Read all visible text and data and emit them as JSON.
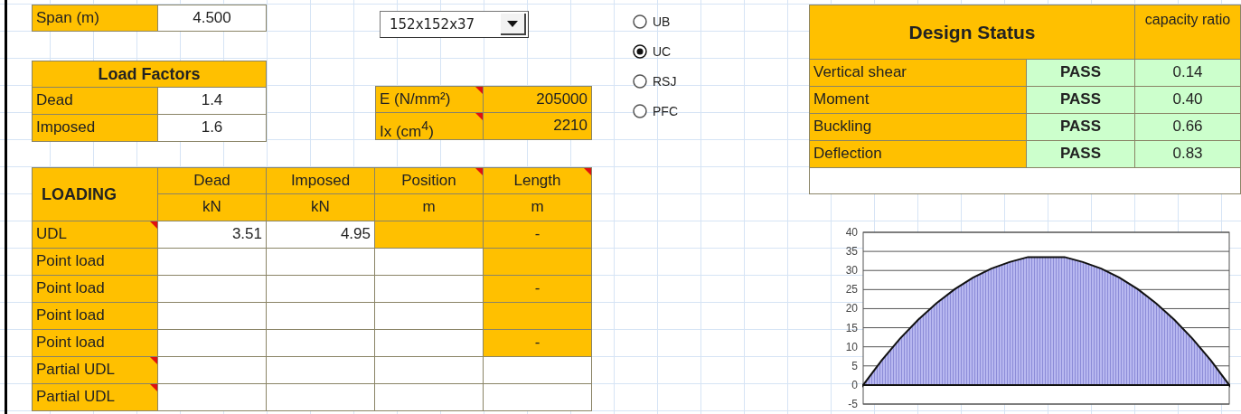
{
  "span": {
    "label": "Span (m)",
    "value": "4.500"
  },
  "load_factors": {
    "title": "Load Factors",
    "rows": [
      {
        "label": "Dead",
        "value": "1.4"
      },
      {
        "label": "Imposed",
        "value": "1.6"
      }
    ]
  },
  "section_dropdown": {
    "value": "152x152x37"
  },
  "properties": [
    {
      "label": "E (N/mm²)",
      "value": "205000",
      "comment": true
    },
    {
      "label": "Ix (cm$^{4}$)",
      "value": "2210",
      "comment": true
    }
  ],
  "section_types": [
    {
      "label": "UB",
      "selected": false
    },
    {
      "label": "UC",
      "selected": true
    },
    {
      "label": "RSJ",
      "selected": false
    },
    {
      "label": "PFC",
      "selected": false
    }
  ],
  "loading": {
    "title": "LOADING",
    "columns": [
      {
        "label": "Dead",
        "unit": "kN",
        "comment": false
      },
      {
        "label": "Imposed",
        "unit": "kN",
        "comment": false
      },
      {
        "label": "Position",
        "unit": "m",
        "comment": true
      },
      {
        "label": "Length",
        "unit": "m",
        "comment": true
      }
    ],
    "rows": [
      {
        "label": "UDL",
        "comment": true,
        "cells": [
          {
            "value": "3.51",
            "shaded": false
          },
          {
            "value": "4.95",
            "shaded": false
          },
          {
            "shaded": true
          },
          {
            "value": "-",
            "shaded": true
          }
        ]
      },
      {
        "label": "Point load",
        "comment": false,
        "cells": [
          {
            "shaded": false
          },
          {
            "shaded": false
          },
          {
            "shaded": false
          },
          {
            "shaded": true
          }
        ]
      },
      {
        "label": "Point load",
        "comment": false,
        "cells": [
          {
            "shaded": false
          },
          {
            "shaded": false
          },
          {
            "shaded": false
          },
          {
            "value": "-",
            "shaded": true
          }
        ]
      },
      {
        "label": "Point load",
        "comment": false,
        "cells": [
          {
            "shaded": false
          },
          {
            "shaded": false
          },
          {
            "shaded": false
          },
          {
            "shaded": true
          }
        ]
      },
      {
        "label": "Point load",
        "comment": false,
        "cells": [
          {
            "shaded": false
          },
          {
            "shaded": false
          },
          {
            "shaded": false
          },
          {
            "value": "-",
            "shaded": true
          }
        ]
      },
      {
        "label": "Partial UDL",
        "comment": true,
        "cells": [
          {
            "shaded": false
          },
          {
            "shaded": false
          },
          {
            "shaded": false
          },
          {
            "shaded": false
          }
        ]
      },
      {
        "label": "Partial UDL",
        "comment": true,
        "cells": [
          {
            "shaded": false
          },
          {
            "shaded": false
          },
          {
            "shaded": false
          },
          {
            "shaded": false
          }
        ]
      }
    ]
  },
  "design_status": {
    "title": "Design Status",
    "ratio_header": "capacity ratio",
    "checks": [
      {
        "label": "Vertical shear",
        "result": "PASS",
        "ratio": "0.14"
      },
      {
        "label": "Moment",
        "result": "PASS",
        "ratio": "0.40"
      },
      {
        "label": "Buckling",
        "result": "PASS",
        "ratio": "0.66"
      },
      {
        "label": "Deflection",
        "result": "PASS",
        "ratio": "0.83"
      }
    ]
  },
  "chart": {
    "chart_data": {
      "type": "area",
      "grid": true,
      "ylim": [
        -5,
        40
      ],
      "yticks": [
        -5,
        0,
        5,
        10,
        15,
        20,
        25,
        30,
        35,
        40
      ],
      "values": [
        0,
        6.4,
        12.1,
        17.1,
        21.4,
        25.1,
        28.1,
        30.5,
        32.2,
        33.5,
        33.5,
        33.5,
        32.2,
        30.5,
        28.1,
        25.1,
        21.4,
        17.1,
        12.1,
        6.4,
        0
      ]
    }
  }
}
